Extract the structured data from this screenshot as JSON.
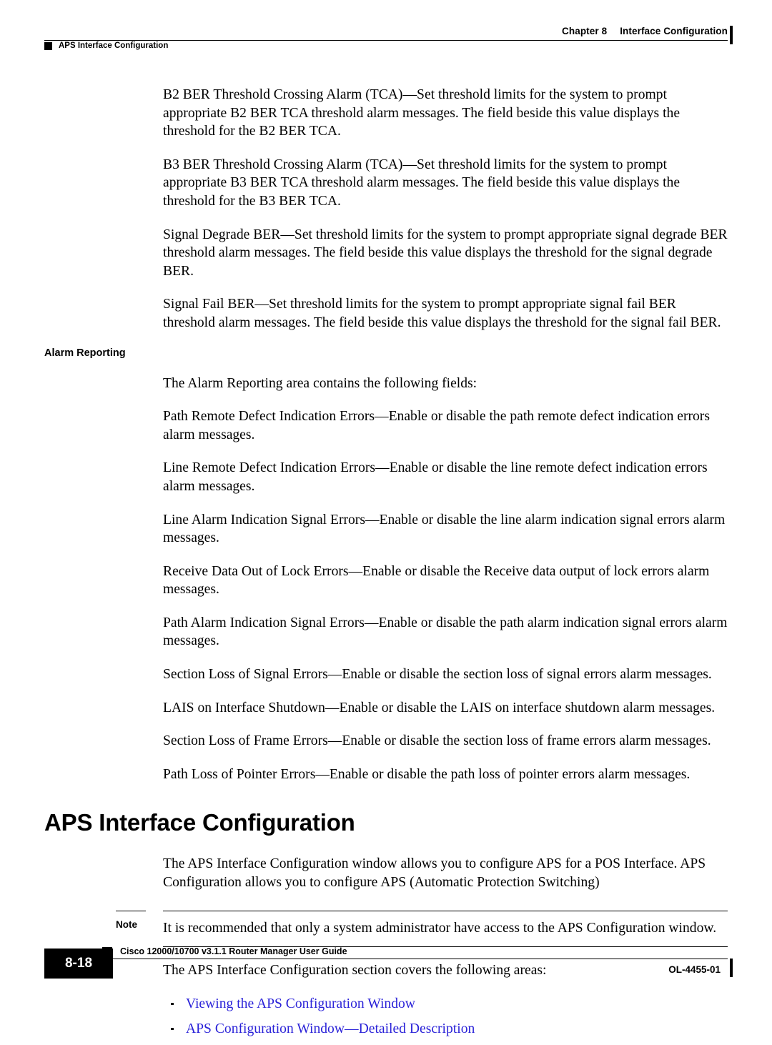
{
  "header": {
    "chapter": "Chapter 8",
    "chapter_title": "Interface Configuration",
    "running_head": "APS Interface Configuration"
  },
  "body": {
    "paragraphs": [
      "B2 BER Threshold Crossing Alarm (TCA)—Set threshold limits for the system to prompt appropriate B2 BER TCA threshold alarm messages. The field beside this value displays the threshold for the B2 BER TCA.",
      "B3 BER Threshold Crossing Alarm (TCA)—Set threshold limits for the system to prompt appropriate B3 BER TCA threshold alarm messages. The field beside this value displays the threshold for the B3 BER TCA.",
      "Signal Degrade BER—Set threshold limits for the system to prompt appropriate signal degrade BER threshold alarm messages. The field beside this value displays the threshold for the signal degrade BER.",
      "Signal Fail BER—Set threshold limits for the system to prompt appropriate signal fail BER threshold alarm messages. The field beside this value displays the threshold for the signal fail BER."
    ],
    "alarm_reporting_heading": "Alarm Reporting",
    "alarm_reporting_intro": "The Alarm Reporting area contains the following fields:",
    "alarm_reporting_fields": [
      "Path Remote Defect Indication Errors—Enable or disable the path remote defect indication errors alarm messages.",
      "Line Remote Defect Indication Errors—Enable or disable the line remote defect indication errors alarm messages.",
      "Line Alarm Indication Signal Errors—Enable or disable the line alarm indication signal errors alarm messages.",
      "Receive Data Out of Lock Errors—Enable or disable the Receive data output of lock errors alarm messages.",
      "Path Alarm Indication Signal Errors—Enable or disable the path alarm indication signal errors alarm messages.",
      "Section Loss of Signal Errors—Enable or disable the section loss of signal errors alarm messages.",
      "LAIS on Interface Shutdown—Enable or disable the LAIS on interface shutdown alarm messages.",
      "Section Loss of Frame Errors—Enable or disable the section loss of frame errors alarm messages.",
      "Path Loss of Pointer Errors—Enable or disable the path loss of pointer errors alarm messages."
    ]
  },
  "section": {
    "title": "APS Interface Configuration",
    "intro": "The APS Interface Configuration window allows you to configure APS for a POS Interface. APS Configuration allows you to configure APS (Automatic Protection Switching)",
    "note_label": "Note",
    "note_text": "It is recommended that only a system administrator have access to the APS Configuration window.",
    "covers_intro": "The APS Interface Configuration section covers the following areas:",
    "links": [
      "Viewing the APS Configuration Window",
      "APS Configuration Window—Detailed Description"
    ],
    "link_color": "#2a22d8"
  },
  "footer": {
    "page_number": "8-18",
    "guide_title": "Cisco 12000/10700 v3.1.1 Router Manager User Guide",
    "doc_id": "OL-4455-01"
  }
}
